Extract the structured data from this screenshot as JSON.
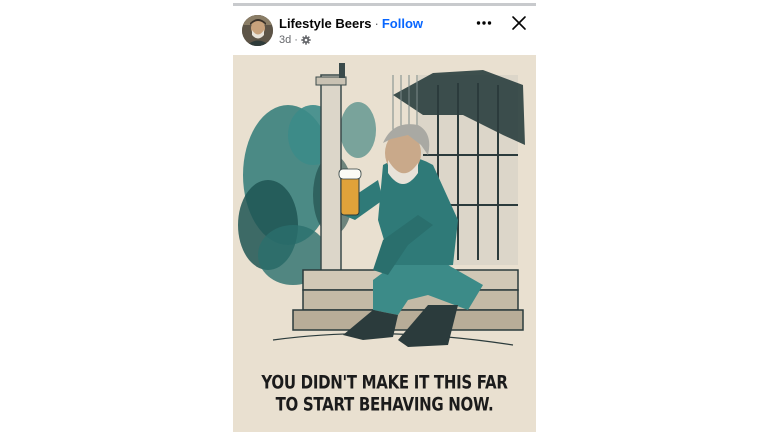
{
  "post": {
    "page_name": "Lifestyle Beers",
    "separator": "·",
    "follow_label": "Follow",
    "age": "3d",
    "meta_separator": "·",
    "audience_icon": "settings-icon",
    "more_icon": "more-horizontal-icon",
    "close_icon": "close-icon"
  },
  "image": {
    "caption_line1": "YOU DIDN'T MAKE IT THIS FAR",
    "caption_line2": "TO START BEHAVING NOW."
  },
  "colors": {
    "follow": "#0866ff",
    "text": "#050505",
    "secondary_text": "#65676b",
    "poster_background": "#e9e0d0",
    "teal_ink": "#2f7a78"
  }
}
